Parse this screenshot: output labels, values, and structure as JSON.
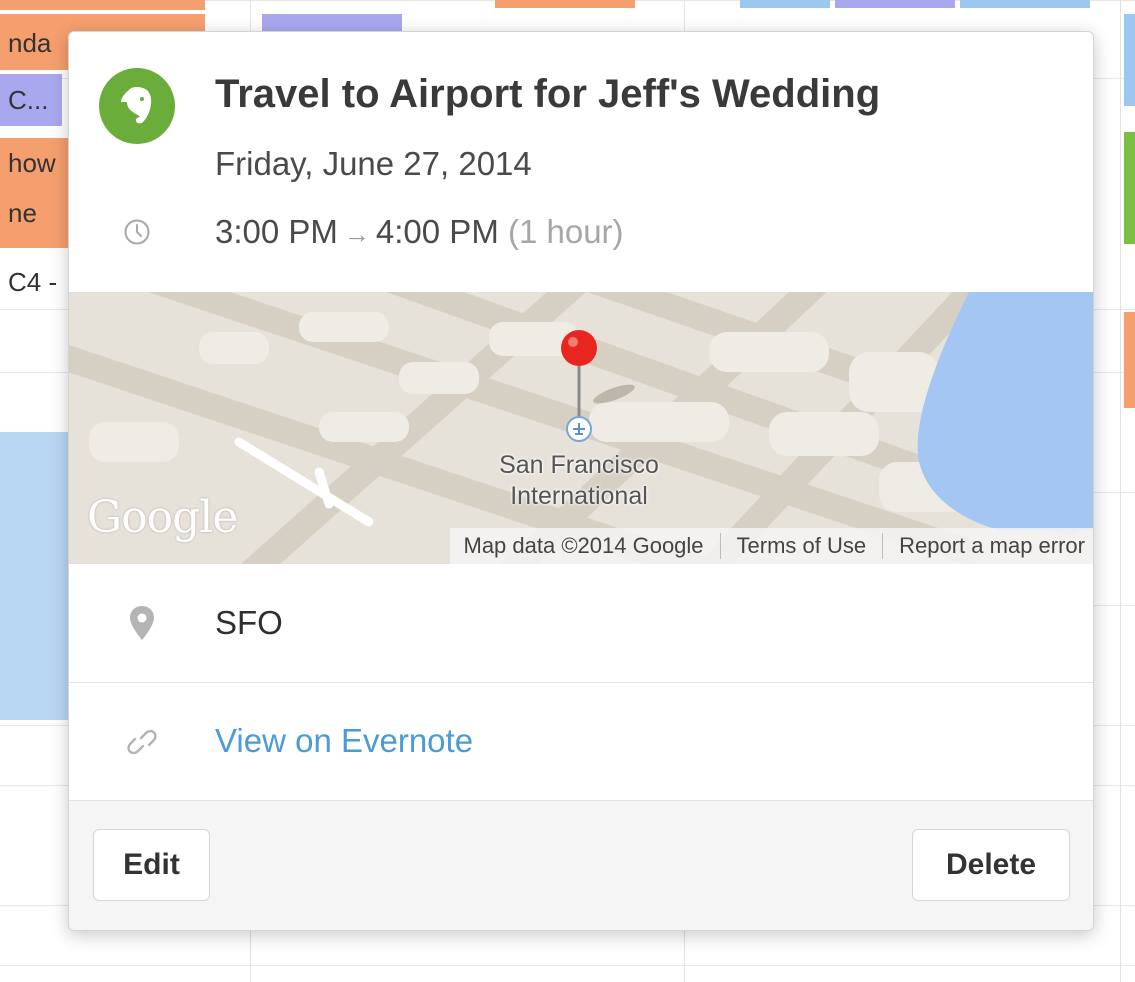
{
  "background_calendar": {
    "event_fragments": [
      "nda",
      "C...",
      "how",
      "ne",
      "C4 -"
    ]
  },
  "event": {
    "source_icon": "evernote-elephant-icon",
    "title": "Travel to Airport for Jeff's Wedding",
    "date": "Friday, June 27, 2014",
    "start_time": "3:00 PM",
    "arrow": "→",
    "end_time": "4:00 PM",
    "duration": "(1 hour)",
    "location": "SFO",
    "link_label": "View on Evernote"
  },
  "map": {
    "logo": "Google",
    "place_label_line1": "San Francisco",
    "place_label_line2": "International",
    "attribution": {
      "map_data": "Map data ©2014 Google",
      "terms": "Terms of Use",
      "report": "Report a map error"
    }
  },
  "actions": {
    "edit_label": "Edit",
    "delete_label": "Delete"
  },
  "colors": {
    "evernote_green": "#6aad3a",
    "link_blue": "#4a9bd6",
    "pin_red": "#e8261f",
    "water_blue": "#a4c6f3"
  }
}
